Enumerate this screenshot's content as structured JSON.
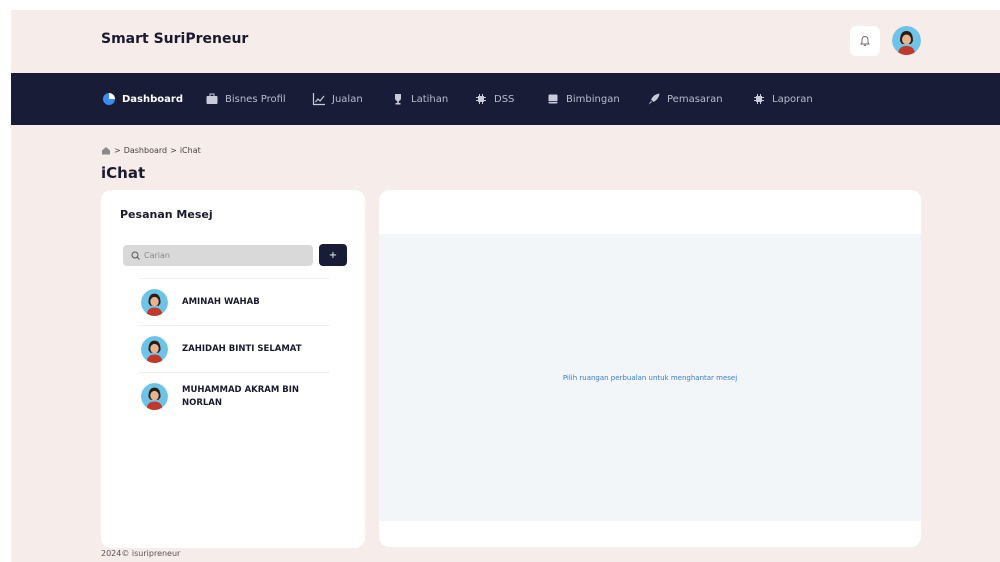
{
  "app": {
    "title": "Smart SuriPreneur"
  },
  "nav": {
    "items": [
      {
        "label": "Dashboard",
        "icon": "pie-chart-icon",
        "active": true
      },
      {
        "label": "Bisnes Profil",
        "icon": "briefcase-icon",
        "active": false
      },
      {
        "label": "Jualan",
        "icon": "line-chart-icon",
        "active": false
      },
      {
        "label": "Latihan",
        "icon": "trophy-icon",
        "active": false
      },
      {
        "label": "DSS",
        "icon": "chip-icon",
        "active": false
      },
      {
        "label": "Bimbingan",
        "icon": "book-icon",
        "active": false
      },
      {
        "label": "Pemasaran",
        "icon": "rocket-icon",
        "active": false
      },
      {
        "label": "Laporan",
        "icon": "chip-icon",
        "active": false
      }
    ]
  },
  "breadcrumb": {
    "items": [
      "Dashboard",
      "iChat"
    ],
    "separator": ">"
  },
  "page": {
    "title": "iChat"
  },
  "messages": {
    "title": "Pesanan Mesej",
    "search_placeholder": "Carian",
    "add_label": "+",
    "contacts": [
      {
        "name": "AMINAH WAHAB"
      },
      {
        "name": "ZAHIDAH BINTI SELAMAT"
      },
      {
        "name": "MUHAMMAD AKRAM BIN NORLAN"
      }
    ]
  },
  "chat": {
    "empty_hint": "Pilih ruangan perbualan untuk menghantar mesej"
  },
  "footer": {
    "text": "2024© isuripreneur"
  },
  "colors": {
    "nav_bg": "#181c36",
    "page_bg": "#f6ece9",
    "accent": "#3a7bd5",
    "active_icon": "#3b8bf5"
  }
}
